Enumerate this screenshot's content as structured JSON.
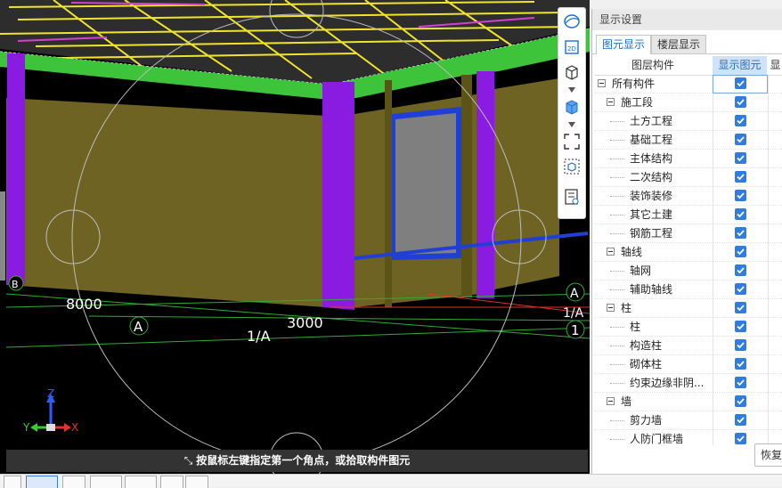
{
  "viewport": {
    "status_text": "按鼠标左键指定第一个角点，或拾取构件图元",
    "dimensions": [
      "8000",
      "3000"
    ],
    "axis_labels": [
      "A",
      "1/A",
      "A",
      "1/A",
      "1",
      "B"
    ],
    "axes_gizmo": {
      "z": "Z",
      "y": "Y",
      "x": "X"
    },
    "colors": {
      "background": "#000000",
      "slab_edge": "#3ec43a",
      "column": "#8a1be0",
      "wall": "#6e6323",
      "rebar": "#f0e52a",
      "window_frame": "#1f3fd6",
      "glass": "#7f7f7f"
    }
  },
  "vtoolbar": {
    "items": [
      "orbit-icon",
      "2d-view-icon",
      "3d-box-icon",
      "solid-box-icon",
      "zoom-extents-icon",
      "cube-view-icon",
      "display-list-icon"
    ]
  },
  "panel": {
    "title": "显示设置",
    "tabs": [
      {
        "label": "图元显示",
        "active": true
      },
      {
        "label": "楼层显示",
        "active": false
      }
    ],
    "columns": {
      "name": "图层构件",
      "show": "显示图元",
      "extra": "显"
    },
    "rows": [
      {
        "label": "所有构件",
        "level": 0,
        "checked": true
      },
      {
        "label": "施工段",
        "level": 1,
        "checked": true
      },
      {
        "label": "土方工程",
        "level": 2,
        "checked": true
      },
      {
        "label": "基础工程",
        "level": 2,
        "checked": true
      },
      {
        "label": "主体结构",
        "level": 2,
        "checked": true
      },
      {
        "label": "二次结构",
        "level": 2,
        "checked": true
      },
      {
        "label": "装饰装修",
        "level": 2,
        "checked": true
      },
      {
        "label": "其它土建",
        "level": 2,
        "checked": true
      },
      {
        "label": "钢筋工程",
        "level": 2,
        "checked": true
      },
      {
        "label": "轴线",
        "level": 1,
        "checked": true
      },
      {
        "label": "轴网",
        "level": 2,
        "checked": true
      },
      {
        "label": "辅助轴线",
        "level": 2,
        "checked": true
      },
      {
        "label": "柱",
        "level": 1,
        "checked": true
      },
      {
        "label": "柱",
        "level": 2,
        "checked": true
      },
      {
        "label": "构造柱",
        "level": 2,
        "checked": true
      },
      {
        "label": "砌体柱",
        "level": 2,
        "checked": true
      },
      {
        "label": "约束边缘非阴...",
        "level": 2,
        "checked": true
      },
      {
        "label": "墙",
        "level": 1,
        "checked": true
      },
      {
        "label": "剪力墙",
        "level": 2,
        "checked": true
      },
      {
        "label": "人防门框墙",
        "level": 2,
        "checked": true
      }
    ],
    "restore_label": "恢复"
  }
}
